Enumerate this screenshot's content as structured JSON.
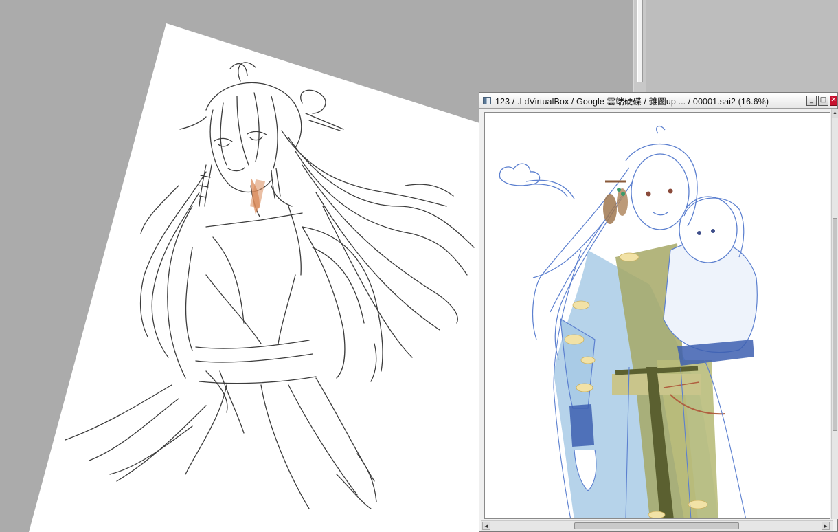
{
  "navigator": {
    "title": "123 / .LdVirtualBox / Google 雲端硬碟 / 雜圖up ... / 00001.sai2 (16.6%)",
    "minimize_label": "_",
    "maximize_label": "□",
    "close_label": "✕"
  },
  "scrollbars": {
    "up_arrow": "▲",
    "left_arrow": "◄",
    "right_arrow": "►"
  },
  "colors": {
    "workspace": "#ababab",
    "canvas": "#ffffff",
    "sketch_line": "#3c3c3c",
    "blue_line": "#4a6fc4",
    "robe_blue": "#a9cbe6",
    "robe_green": "#a6a866",
    "sash_dark": "#5b6030",
    "skin_tone": "#d98a5a",
    "close_button": "#c8102e"
  },
  "icons": [
    "app-icon",
    "minimize-icon",
    "maximize-icon",
    "close-icon"
  ]
}
